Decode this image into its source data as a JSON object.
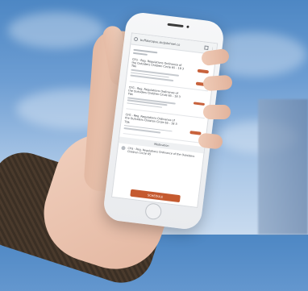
{
  "browser": {
    "url": "buffalotopsu.skdpdoheel.co"
  },
  "list": {
    "entries": [
      {
        "title": "CFG - Reg. Regulations Ordinance of the Outsiders Children Circle 65 - 18 3 Tbk"
      },
      {
        "title": "CFG - Reg. Regulations Ordinance of the Outsiders Children Circle 65 - 18 3 Tbk"
      },
      {
        "title": "CFG - Reg. Regulations Ordinance of the Outsiders Children Circle 65 - 18 3 Tbk"
      }
    ],
    "section_label": "Medication",
    "bottom_entry": "CFG - Reg. Regulations Ordinance of the Outsiders Children Circle 65",
    "cta_label": "SCHEDULE"
  }
}
